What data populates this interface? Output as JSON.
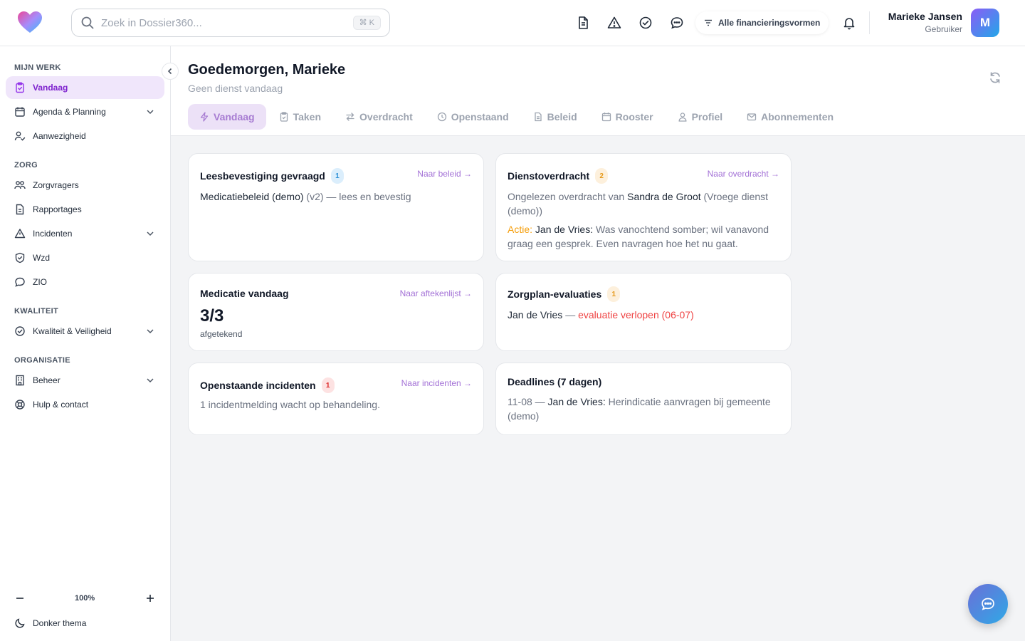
{
  "search": {
    "placeholder": "Zoek in Dossier360...",
    "shortcut": "⌘ K"
  },
  "topbar": {
    "filter_label": "Alle financieringsvormen",
    "user_name": "Marieke Jansen",
    "user_role": "Gebruiker",
    "avatar_initial": "M"
  },
  "sidebar": {
    "sections": {
      "mijn_werk": "MIJN WERK",
      "zorg": "ZORG",
      "kwaliteit": "KWALITEIT",
      "organisatie": "ORGANISATIE"
    },
    "items": {
      "vandaag": "Vandaag",
      "agenda": "Agenda & Planning",
      "aanwezigheid": "Aanwezigheid",
      "zorgvragers": "Zorgvragers",
      "rapportages": "Rapportages",
      "incidenten": "Incidenten",
      "wzd": "Wzd",
      "zio": "ZIO",
      "kwaliteit": "Kwaliteit & Veiligheid",
      "beheer": "Beheer",
      "hulp": "Hulp & contact"
    },
    "zoom": "100%",
    "theme_label": "Donker thema"
  },
  "header": {
    "greeting": "Goedemorgen, Marieke",
    "subtitle": "Geen dienst vandaag",
    "tabs": {
      "vandaag": "Vandaag",
      "taken": "Taken",
      "overdracht": "Overdracht",
      "openstaand": "Openstaand",
      "beleid": "Beleid",
      "rooster": "Rooster",
      "profiel": "Profiel",
      "abonnementen": "Abonnementen"
    }
  },
  "cards": {
    "lees": {
      "title": "Leesbevestiging gevraagd",
      "count": "1",
      "link": "Naar beleid →",
      "doc": "Medicatiebeleid (demo)",
      "rest": " (v2) — lees en bevestig"
    },
    "dienst": {
      "title": "Dienstoverdracht",
      "count": "2",
      "link": "Naar overdracht →",
      "pre": "Ongelezen overdracht van ",
      "name": "Sandra de Groot",
      "post": " (Vroege dienst (demo))",
      "action_label": "Actie:",
      "action_name": " Jan de Vries:",
      "action_text": " Was vanochtend somber; wil vanavond graag een gesprek. Even navragen hoe het nu gaat."
    },
    "medicatie": {
      "title": "Medicatie vandaag",
      "link": "Naar aftekenlijst →",
      "value": "3/3",
      "caption": "afgetekend"
    },
    "zorgplan": {
      "title": "Zorgplan-evaluaties",
      "count": "1",
      "name": "Jan de Vries",
      "sep": " — ",
      "status": "evaluatie verlopen (06-07)"
    },
    "incidenten": {
      "title": "Openstaande incidenten",
      "count": "1",
      "link": "Naar incidenten →",
      "text": "1 incidentmelding wacht op behandeling."
    },
    "deadlines": {
      "title": "Deadlines (7 dagen)",
      "date": "11-08 — ",
      "name": "Jan de Vries:",
      "text": " Herindicatie aanvragen bij gemeente (demo)"
    }
  }
}
